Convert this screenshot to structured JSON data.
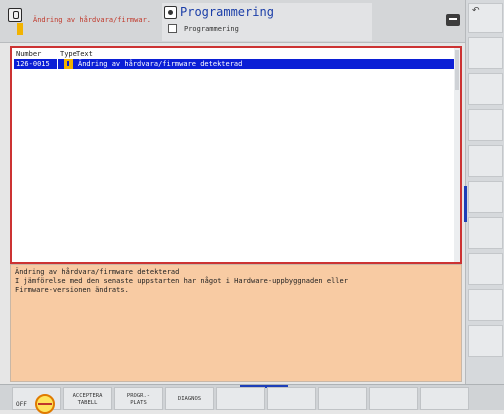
{
  "header": {
    "message_text": "Ändring av hårdvara/firmwar.",
    "mode_title": "Programmering",
    "mode_sub": "Programmering"
  },
  "table": {
    "columns": [
      "Number",
      "Type",
      "Text"
    ],
    "rows": [
      {
        "number": "126-0015",
        "text": "Ändring av hårdvara/firmware detekterad"
      }
    ]
  },
  "detail": {
    "lines": [
      "Ändring av hårdvara/firmware detekterad",
      "I jämförelse med den senaste uppstarten har något i Hardware-uppbyggnaden eller",
      "Firmware-versionen ändrats."
    ]
  },
  "softkeys": [
    {
      "line1": "OFF",
      "line2": ""
    },
    {
      "line1": "ACCEPTERA",
      "line2": "TABELL"
    },
    {
      "line1": "PROGR.-",
      "line2": "PLATS"
    },
    {
      "line1": "DIAGNOS",
      "line2": ""
    }
  ],
  "colors": {
    "selection": "#0b1fd6",
    "title_blue": "#1b3ea8",
    "detail_bg": "#f8cba3",
    "error_red": "#c0392b"
  }
}
